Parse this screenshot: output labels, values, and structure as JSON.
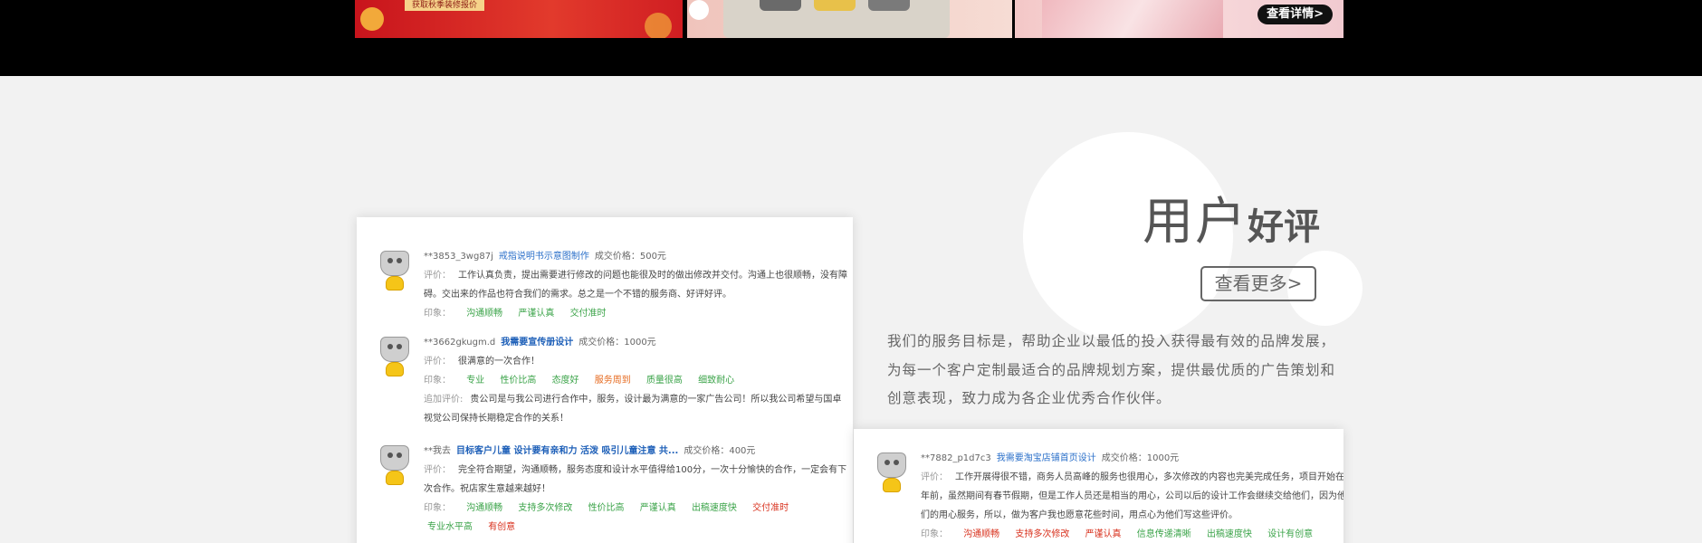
{
  "banners": {
    "promo_text": "获取秋季装修报价",
    "detail_button": "查看详情>"
  },
  "section": {
    "title_light": "用户",
    "title_bold": "好评",
    "more_button": "查看更多>",
    "intro": "我们的服务目标是，帮助企业以最低的投入获得最有效的品牌发展，为每一个客户定制最适合的品牌规划方案，提供最优质的广告策划和创意表现，致力成为各企业优秀合作伙伴。"
  },
  "labels": {
    "comment": "评价：",
    "impression": "印象：",
    "followup": "追加评价:",
    "price_prefix": "成交价格："
  },
  "reviews_left": [
    {
      "user": "**3853_3wg87j",
      "project": "戒指说明书示意图制作",
      "project_strong": false,
      "price": "500元",
      "comment": "工作认真负责，提出需要进行修改的问题也能很及时的做出修改并交付。沟通上也很顺畅，没有障碍。交出来的作品也符合我们的需求。总之是一个不错的服务商、好评好评。",
      "tags": [
        {
          "text": "沟通顺畅",
          "color": "green"
        },
        {
          "text": "严谨认真",
          "color": "green"
        },
        {
          "text": "交付准时",
          "color": "green"
        }
      ]
    },
    {
      "user": "**3662gkugm.d",
      "project": "我需要宣传册设计",
      "project_strong": true,
      "price": "1000元",
      "comment": "很满意的一次合作！",
      "tags": [
        {
          "text": "专业",
          "color": "green"
        },
        {
          "text": "性价比高",
          "color": "green"
        },
        {
          "text": "态度好",
          "color": "green"
        },
        {
          "text": "服务周到",
          "color": "orange"
        },
        {
          "text": "质量很高",
          "color": "green"
        },
        {
          "text": "细致耐心",
          "color": "green"
        }
      ],
      "followup": "贵公司是与我公司进行合作中，服务，设计最为满意的一家广告公司！所以我公司希望与国卓视觉公司保持长期稳定合作的关系！"
    },
    {
      "user": "**我去",
      "project": "目标客户儿童   设计要有亲和力  活泼   吸引儿童注意   共...",
      "project_strong": true,
      "price": "400元",
      "comment": "完全符合期望，沟通顺畅，服务态度和设计水平值得给100分，一次十分愉快的合作，一定会有下次合作。祝店家生意越来越好！",
      "tags": [
        {
          "text": "沟通顺畅",
          "color": "green"
        },
        {
          "text": "支持多次修改",
          "color": "green"
        },
        {
          "text": "性价比高",
          "color": "green"
        },
        {
          "text": "严谨认真",
          "color": "green"
        },
        {
          "text": "出稿速度快",
          "color": "green"
        },
        {
          "text": "交付准时",
          "color": "red"
        },
        {
          "text": "专业水平高",
          "color": "green"
        },
        {
          "text": "有创意",
          "color": "red"
        }
      ]
    }
  ],
  "review_right": {
    "user": "**7882_p1d7c3",
    "project": "我需要淘宝店铺首页设计",
    "price": "1000元",
    "comment": "工作开展得很不错，商务人员高峰的服务也很用心，多次修改的内容也完美完成任务，项目开始在年前，虽然期间有春节假期，但是工作人员还是相当的用心，公司以后的设计工作会继续交给他们，因为他们的用心服务，所以，做为客户我也愿意花些时间，用点心为他们写这些评价。",
    "tags": [
      {
        "text": "沟通顺畅",
        "color": "red"
      },
      {
        "text": "支持多次修改",
        "color": "red"
      },
      {
        "text": "严谨认真",
        "color": "red"
      },
      {
        "text": "信息传递清晰",
        "color": "green"
      },
      {
        "text": "出稿速度快",
        "color": "green"
      },
      {
        "text": "设计有创意",
        "color": "green"
      }
    ]
  }
}
